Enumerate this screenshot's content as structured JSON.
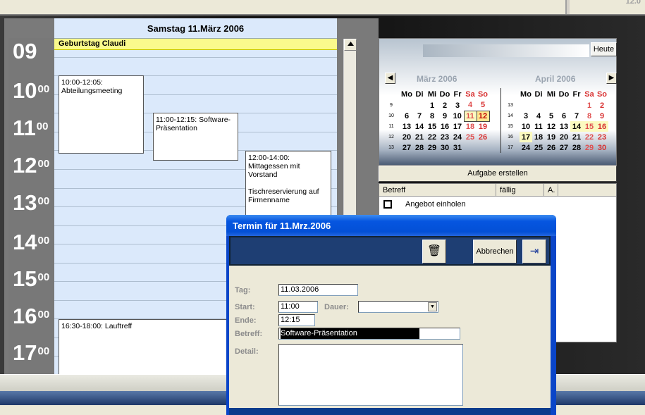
{
  "clock_partial": "12.0",
  "day": {
    "header": "Samstag 11.März 2006",
    "allday_event": "Geburtstag Claudi",
    "hours": [
      {
        "h": "09",
        "m": ""
      },
      {
        "h": "10",
        "m": "00"
      },
      {
        "h": "11",
        "m": "00"
      },
      {
        "h": "12",
        "m": "00"
      },
      {
        "h": "13",
        "m": "00"
      },
      {
        "h": "14",
        "m": "00"
      },
      {
        "h": "15",
        "m": "00"
      },
      {
        "h": "16",
        "m": "00"
      },
      {
        "h": "17",
        "m": "00"
      }
    ],
    "appointments": [
      {
        "text": "10:00-12:05: Abteilungsmeeting"
      },
      {
        "text": "11:00-12:15: Software-Präsentation"
      },
      {
        "line1": "12:00-14:00: Mittagessen mit Vorstand",
        "line2": "Tischreservierung auf Firmenname"
      },
      {
        "text": "16:30-18:00: Lauftreff"
      }
    ]
  },
  "minical": {
    "heute_label": "Heute",
    "prev_icon": "◀",
    "next_icon": "▶",
    "weekdays": [
      "Mo",
      "Di",
      "Mi",
      "Do",
      "Fr",
      "Sa",
      "So"
    ],
    "months": [
      {
        "title": "März 2006",
        "weeks": [
          {
            "wk": "9",
            "days": [
              "",
              "",
              "1",
              "2",
              "3",
              "4",
              "5"
            ]
          },
          {
            "wk": "10",
            "days": [
              "6",
              "7",
              "8",
              "9",
              "10",
              "11",
              "12"
            ]
          },
          {
            "wk": "11",
            "days": [
              "13",
              "14",
              "15",
              "16",
              "17",
              "18",
              "19"
            ]
          },
          {
            "wk": "12",
            "days": [
              "20",
              "21",
              "22",
              "23",
              "24",
              "25",
              "26"
            ]
          },
          {
            "wk": "13",
            "days": [
              "27",
              "28",
              "29",
              "30",
              "31",
              "",
              ""
            ]
          }
        ]
      },
      {
        "title": "April 2006",
        "weeks": [
          {
            "wk": "13",
            "days": [
              "",
              "",
              "",
              "",
              "",
              "1",
              "2"
            ]
          },
          {
            "wk": "14",
            "days": [
              "3",
              "4",
              "5",
              "6",
              "7",
              "8",
              "9"
            ]
          },
          {
            "wk": "15",
            "days": [
              "10",
              "11",
              "12",
              "13",
              "14",
              "15",
              "16"
            ]
          },
          {
            "wk": "16",
            "days": [
              "17",
              "18",
              "19",
              "20",
              "21",
              "22",
              "23"
            ]
          },
          {
            "wk": "17",
            "days": [
              "24",
              "25",
              "26",
              "27",
              "28",
              "29",
              "30"
            ]
          }
        ]
      }
    ]
  },
  "tasks": {
    "create_button": "Aufgabe erstellen",
    "columns": [
      "Betreff",
      "fällig",
      "A."
    ],
    "rows": [
      {
        "subject": "Angebot einholen",
        "due": "",
        "a": ""
      }
    ]
  },
  "dialog": {
    "title": "Termin für 11.Mrz.2006",
    "delete_icon": "🗑",
    "cancel_label": "Abbrechen",
    "exit_icon": "⇥",
    "labels": {
      "tag": "Tag:",
      "start": "Start:",
      "dauer": "Dauer:",
      "ende": "Ende:",
      "betreff": "Betreff:",
      "detail": "Detail:"
    },
    "values": {
      "tag": "11.03.2006",
      "start": "11:00",
      "dauer": "",
      "ende": "12:15",
      "betreff": "Software-Präsentation",
      "detail": ""
    }
  }
}
